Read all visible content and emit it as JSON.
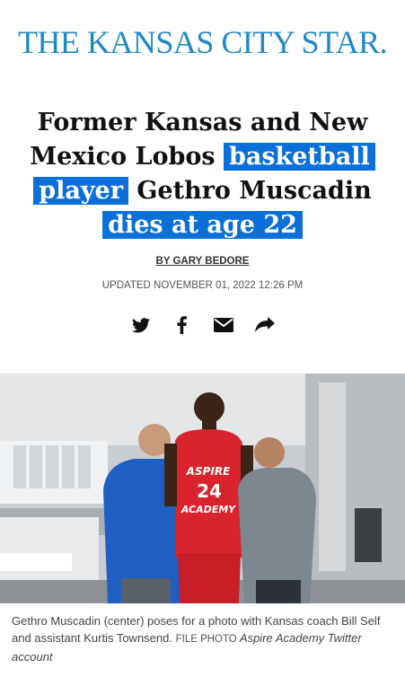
{
  "masthead": "THE KANSAS CITY STAR.",
  "headline": {
    "part1": "Former Kansas and New Mexico Lobos ",
    "hl1": "basketball",
    "hl2": "player",
    "part2": " Gethro Muscadin ",
    "hl3": "dies at age 22"
  },
  "byline": "BY GARY BEDORE",
  "updated": "UPDATED NOVEMBER 01, 2022 12:26 PM",
  "share_icons": [
    "twitter-icon",
    "facebook-icon",
    "email-icon",
    "share-icon"
  ],
  "photo": {
    "jersey_line1": "ASPIRE",
    "jersey_number": "24",
    "jersey_line2": "ACADEMY"
  },
  "caption": {
    "text": "Gethro Muscadin (center) poses for a photo with Kansas coach Bill Self and assistant Kurtis Townsend. ",
    "credit_label": "FILE PHOTO",
    "credit_source": " Aspire Academy Twitter account"
  },
  "colors": {
    "brand": "#1e88c7",
    "highlight": "#0a6fd8"
  }
}
